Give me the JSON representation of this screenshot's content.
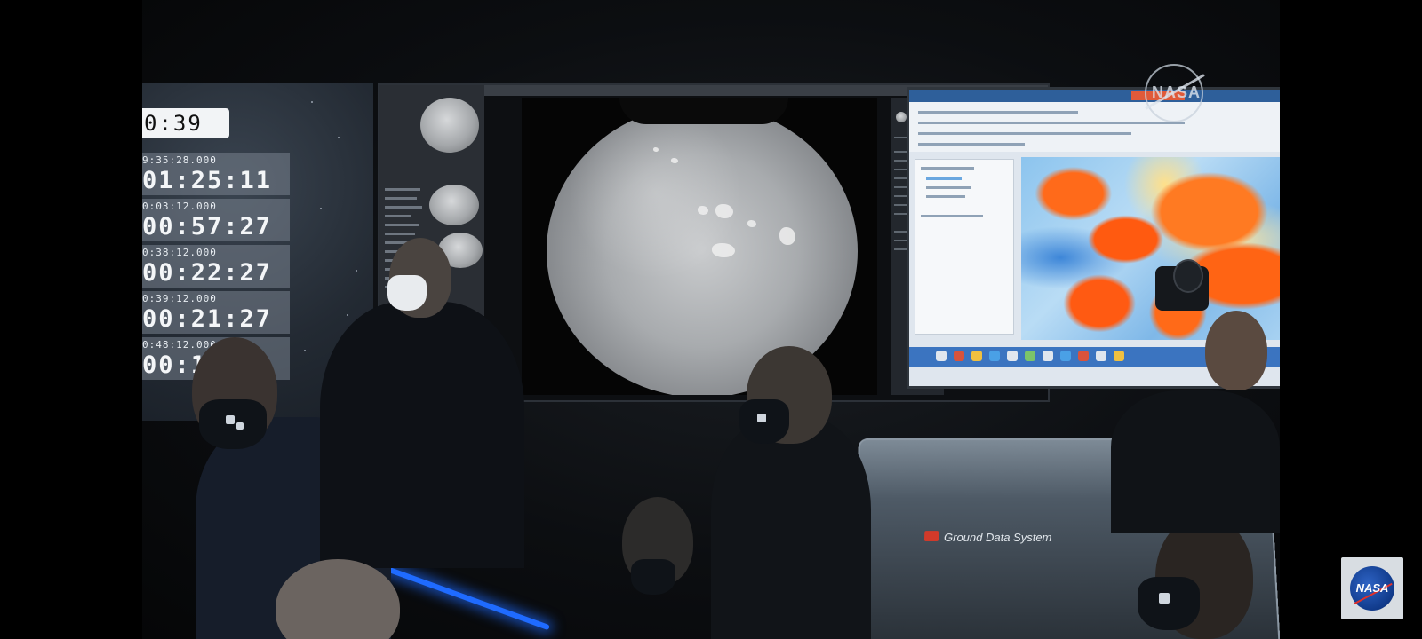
{
  "clock_wall": {
    "top_clock": "0:39",
    "rows": [
      {
        "timestamp": "9:35:28.000",
        "countdown": "01:25:11"
      },
      {
        "timestamp": "0:03:12.000",
        "countdown": "00:57:27"
      },
      {
        "timestamp": "0:38:12.000",
        "countdown": "00:22:27"
      },
      {
        "timestamp": "0:39:12.000",
        "countdown": "00:21:27"
      },
      {
        "timestamp": "0:48:12.000",
        "countdown": "00:1"
      }
    ]
  },
  "image_screen": {
    "subject": "mars-surface-image"
  },
  "data_screen": {
    "colors": {
      "hot": "#ff6a1a",
      "cool": "#8cc4ee",
      "bar": "#2e5f9a"
    }
  },
  "ground_laptop": {
    "label": "Ground Data System"
  },
  "nasa_wall_logo": {
    "text": "NASA"
  },
  "badge": {
    "text": "NASA"
  }
}
